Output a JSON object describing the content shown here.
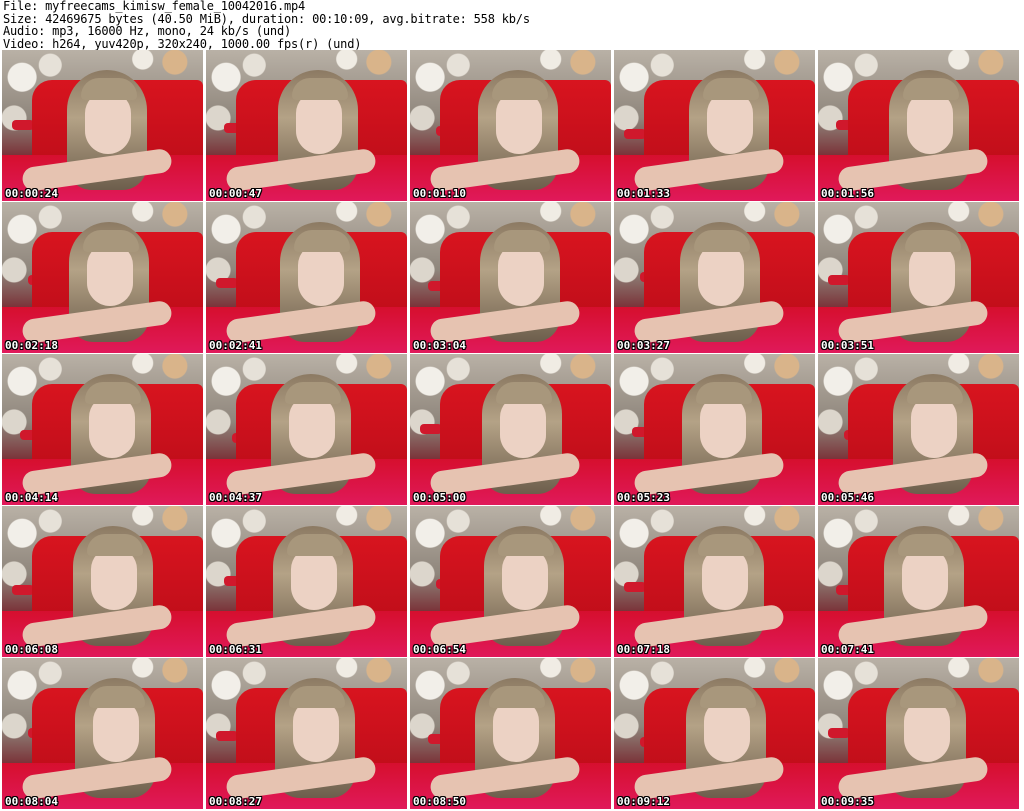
{
  "header": {
    "file": "File: myfreecams_kimisw_female_10042016.mp4",
    "size": "Size: 42469675 bytes (40.50 MiB), duration: 00:10:09, avg.bitrate: 558 kb/s",
    "audio": "Audio: mp3, 16000 Hz, mono, 24 kb/s (und)",
    "video": "Video: h264, yuv420p, 320x240, 1000.00 fps(r) (und)"
  },
  "thumbnails": [
    {
      "timestamp": "00:00:24"
    },
    {
      "timestamp": "00:00:47"
    },
    {
      "timestamp": "00:01:10"
    },
    {
      "timestamp": "00:01:33"
    },
    {
      "timestamp": "00:01:56"
    },
    {
      "timestamp": "00:02:18"
    },
    {
      "timestamp": "00:02:41"
    },
    {
      "timestamp": "00:03:04"
    },
    {
      "timestamp": "00:03:27"
    },
    {
      "timestamp": "00:03:51"
    },
    {
      "timestamp": "00:04:14"
    },
    {
      "timestamp": "00:04:37"
    },
    {
      "timestamp": "00:05:00"
    },
    {
      "timestamp": "00:05:23"
    },
    {
      "timestamp": "00:05:46"
    },
    {
      "timestamp": "00:06:08"
    },
    {
      "timestamp": "00:06:31"
    },
    {
      "timestamp": "00:06:54"
    },
    {
      "timestamp": "00:07:18"
    },
    {
      "timestamp": "00:07:41"
    },
    {
      "timestamp": "00:08:04"
    },
    {
      "timestamp": "00:08:27"
    },
    {
      "timestamp": "00:08:50"
    },
    {
      "timestamp": "00:09:12"
    },
    {
      "timestamp": "00:09:35"
    }
  ]
}
